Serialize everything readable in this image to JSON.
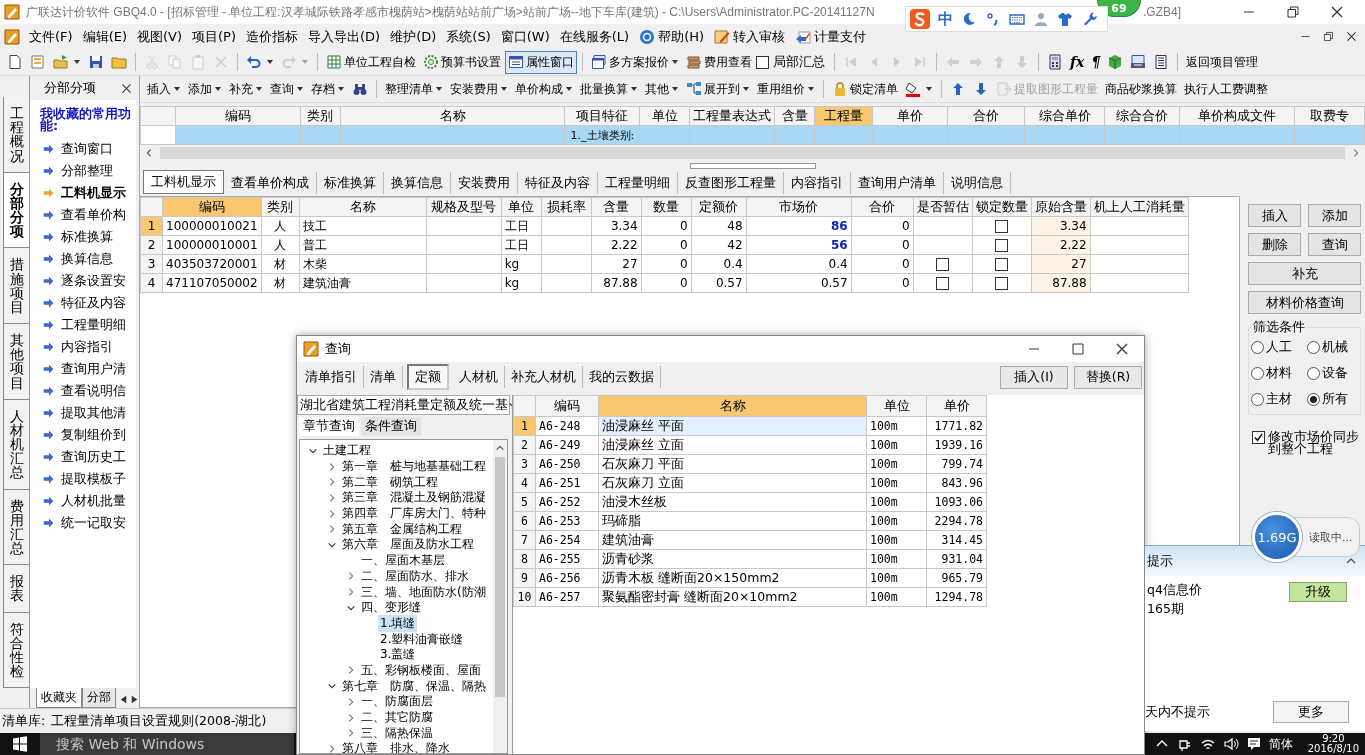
{
  "window": {
    "title": "广联达计价软件 GBQ4.0 - [招标管理 - 单位工程:汉孝城际铁路孝感市槐荫站>槐荫站站前广场>站前广场--地下车库(建筑) - C:\\Users\\Administrator.PC-20141127N",
    "title_end": ".GZB4]"
  },
  "badge": "69",
  "ime_bar": {
    "mode": "中"
  },
  "menu": [
    {
      "kind": "logo"
    },
    {
      "kind": "text",
      "label": "文件(F)"
    },
    {
      "kind": "text",
      "label": "编辑(E)"
    },
    {
      "kind": "text",
      "label": "视图(V)"
    },
    {
      "kind": "text",
      "label": "项目(P)"
    },
    {
      "kind": "text",
      "label": "造价指标"
    },
    {
      "kind": "text",
      "label": "导入导出(D)"
    },
    {
      "kind": "text",
      "label": "维护(D)"
    },
    {
      "kind": "text",
      "label": "系统(S)"
    },
    {
      "kind": "text",
      "label": "窗口(W)"
    },
    {
      "kind": "text",
      "label": "在线服务(L)"
    },
    {
      "kind": "help",
      "label": "帮助(H)"
    },
    {
      "kind": "review",
      "label": "转入审核"
    },
    {
      "kind": "pay",
      "label": "计量支付"
    }
  ],
  "toolbar_main": [
    {
      "kind": "new"
    },
    {
      "kind": "template"
    },
    {
      "kind": "open",
      "dropdown": true
    },
    {
      "kind": "save"
    },
    {
      "kind": "folder"
    },
    {
      "kind": "sep"
    },
    {
      "kind": "cut",
      "disabled": true
    },
    {
      "kind": "copy",
      "disabled": true
    },
    {
      "kind": "paste",
      "disabled": true
    },
    {
      "kind": "del",
      "disabled": true
    },
    {
      "kind": "sep"
    },
    {
      "kind": "undo",
      "dropdown": true,
      "disabled": false
    },
    {
      "kind": "redo",
      "dropdown": true,
      "disabled": true
    },
    {
      "kind": "sep"
    },
    {
      "kind": "check",
      "label": "单位工程自检"
    },
    {
      "kind": "gear",
      "label": "预算书设置"
    },
    {
      "kind": "window",
      "label": "属性窗口",
      "pressed": true
    },
    {
      "kind": "sep"
    },
    {
      "kind": "plans",
      "label": "多方案报价",
      "dropdown": true
    },
    {
      "kind": "fee",
      "label": "费用查看"
    },
    {
      "kind": "checkbox",
      "label": "局部汇总",
      "checked": false
    },
    {
      "kind": "sep"
    },
    {
      "kind": "first",
      "disabled": true
    },
    {
      "kind": "prev",
      "disabled": true
    },
    {
      "kind": "next",
      "disabled": true
    },
    {
      "kind": "last",
      "disabled": true
    },
    {
      "kind": "sep"
    },
    {
      "kind": "left",
      "disabled": true
    },
    {
      "kind": "right",
      "disabled": true
    },
    {
      "kind": "up",
      "disabled": true
    },
    {
      "kind": "down",
      "disabled": true
    },
    {
      "kind": "sep"
    },
    {
      "kind": "calc"
    },
    {
      "kind": "glyph",
      "label": "fx"
    },
    {
      "kind": "glyph",
      "label": "¶"
    },
    {
      "kind": "cube"
    },
    {
      "kind": "report"
    },
    {
      "kind": "list"
    },
    {
      "kind": "sep"
    },
    {
      "kind": "text",
      "label": "返回项目管理"
    }
  ],
  "side_tabs": [
    {
      "label": "工程概况",
      "selected": false
    },
    {
      "label": "分部分项",
      "selected": true
    },
    {
      "label": "措施项目",
      "selected": false
    },
    {
      "label": "其他项目",
      "selected": false
    },
    {
      "label": "人材机汇总",
      "selected": false
    },
    {
      "label": "费用汇总",
      "selected": false
    },
    {
      "label": "报表",
      "selected": false
    },
    {
      "label": "符合性检",
      "selected": false
    }
  ],
  "side_panel": {
    "title": "分部分项",
    "heading": "我收藏的常用功能:",
    "items": [
      {
        "label": "查询窗口",
        "selected": false
      },
      {
        "label": "分部整理",
        "selected": false
      },
      {
        "label": "工料机显示",
        "selected": true
      },
      {
        "label": "查看单价构",
        "selected": false
      },
      {
        "label": "标准换算",
        "selected": false
      },
      {
        "label": "换算信息",
        "selected": false
      },
      {
        "label": "逐条设置安",
        "selected": false
      },
      {
        "label": "特征及内容",
        "selected": false
      },
      {
        "label": "工程量明细",
        "selected": false
      },
      {
        "label": "内容指引",
        "selected": false
      },
      {
        "label": "查询用户清",
        "selected": false
      },
      {
        "label": "查看说明信",
        "selected": false
      },
      {
        "label": "提取其他清",
        "selected": false
      },
      {
        "label": "复制组价到",
        "selected": false
      },
      {
        "label": "查询历史工",
        "selected": false
      },
      {
        "label": "提取模板子",
        "selected": false
      },
      {
        "label": "人材机批量",
        "selected": false
      },
      {
        "label": "统一记取安",
        "selected": false
      }
    ],
    "bottom_tabs": [
      {
        "label": "收藏夹",
        "selected": true
      },
      {
        "label": "分部",
        "selected": false
      }
    ]
  },
  "toolbar_edit": [
    {
      "kind": "text",
      "label": "插入",
      "dropdown": true
    },
    {
      "kind": "text",
      "label": "添加",
      "dropdown": true
    },
    {
      "kind": "text",
      "label": "补充",
      "dropdown": true
    },
    {
      "kind": "text",
      "label": "查询",
      "dropdown": true
    },
    {
      "kind": "text",
      "label": "存档",
      "dropdown": true
    },
    {
      "kind": "binoculars"
    },
    {
      "kind": "sep"
    },
    {
      "kind": "text",
      "label": "整理清单",
      "dropdown": true
    },
    {
      "kind": "text",
      "label": "安装费用",
      "dropdown": true
    },
    {
      "kind": "text",
      "label": "单价构成",
      "dropdown": true
    },
    {
      "kind": "text",
      "label": "批量换算",
      "dropdown": true
    },
    {
      "kind": "text",
      "label": "其他",
      "dropdown": true
    },
    {
      "kind": "expand",
      "label": "展开到",
      "dropdown": true
    },
    {
      "kind": "text",
      "label": "重用组价",
      "dropdown": true
    },
    {
      "kind": "sep"
    },
    {
      "kind": "lock",
      "label": "锁定清单"
    },
    {
      "kind": "paint",
      "dropdown": true
    },
    {
      "kind": "sep"
    },
    {
      "kind": "bup"
    },
    {
      "kind": "bdown"
    },
    {
      "kind": "extract",
      "label": "提取图形工程量",
      "disabled": true
    },
    {
      "kind": "text",
      "label": "商品砂浆换算"
    },
    {
      "kind": "text",
      "label": "执行人工费调整"
    }
  ],
  "item_grid": {
    "columns": [
      {
        "label": "编码",
        "selected": false
      },
      {
        "label": "类别",
        "selected": false
      },
      {
        "label": "名称",
        "selected": false
      },
      {
        "label": "项目特征",
        "selected": false
      },
      {
        "label": "单位",
        "selected": false
      },
      {
        "label": "工程量表达式",
        "selected": false
      },
      {
        "label": "含量",
        "selected": false
      },
      {
        "label": "工程量",
        "selected": true
      },
      {
        "label": "单价",
        "selected": false
      },
      {
        "label": "合价",
        "selected": false
      },
      {
        "label": "综合单价",
        "selected": false
      },
      {
        "label": "综合合价",
        "selected": false
      },
      {
        "label": "单价构成文件",
        "selected": false
      },
      {
        "label": "取费专",
        "selected": false
      }
    ],
    "rows": [
      {
        "selected": true,
        "feature": "1._土壤类别:"
      }
    ]
  },
  "detail_tabs": [
    {
      "label": "工料机显示",
      "selected": true
    },
    {
      "label": "查看单价构成",
      "selected": false
    },
    {
      "label": "标准换算",
      "selected": false
    },
    {
      "label": "换算信息",
      "selected": false
    },
    {
      "label": "安装费用",
      "selected": false
    },
    {
      "label": "特征及内容",
      "selected": false
    },
    {
      "label": "工程量明细",
      "selected": false
    },
    {
      "label": "反查图形工程量",
      "selected": false
    },
    {
      "label": "内容指引",
      "selected": false
    },
    {
      "label": "查询用户清单",
      "selected": false
    },
    {
      "label": "说明信息",
      "selected": false
    }
  ],
  "resources": {
    "columns": [
      {
        "label": "编码",
        "selected": true
      },
      {
        "label": "类别",
        "selected": false
      },
      {
        "label": "名称",
        "selected": false
      },
      {
        "label": "规格及型号",
        "selected": false
      },
      {
        "label": "单位",
        "selected": false
      },
      {
        "label": "损耗率",
        "selected": false
      },
      {
        "label": "含量",
        "selected": false
      },
      {
        "label": "数量",
        "selected": false
      },
      {
        "label": "定额价",
        "selected": false
      },
      {
        "label": "市场价",
        "selected": false
      },
      {
        "label": "合价",
        "selected": false
      },
      {
        "label": "是否暂估",
        "selected": false
      },
      {
        "label": "锁定数量",
        "selected": false
      },
      {
        "label": "原始含量",
        "selected": false
      },
      {
        "label": "机上人工消耗量",
        "selected": false
      }
    ],
    "rows": [
      {
        "no": "1",
        "selected": true,
        "code": "100000010021",
        "type": "人",
        "name": "技工",
        "unit": "工日",
        "content": "3.34",
        "qty": "0",
        "quota_price": "48",
        "market_price": "86",
        "market_changed": true,
        "total": "0",
        "locked": false,
        "original": "3.34"
      },
      {
        "no": "2",
        "selected": false,
        "code": "100000010001",
        "type": "人",
        "name": "普工",
        "unit": "工日",
        "content": "2.22",
        "qty": "0",
        "quota_price": "42",
        "market_price": "56",
        "market_changed": true,
        "total": "0",
        "locked": false,
        "original": "2.22"
      },
      {
        "no": "3",
        "selected": false,
        "code": "403503720001",
        "type": "材",
        "name": "木柴",
        "unit": "kg",
        "content": "27",
        "qty": "0",
        "quota_price": "0.4",
        "market_price": "0.4",
        "market_changed": false,
        "total": "0",
        "estimate": false,
        "locked": false,
        "original": "27"
      },
      {
        "no": "4",
        "selected": false,
        "code": "471107050002",
        "type": "材",
        "name": "建筑油膏",
        "unit": "kg",
        "content": "87.88",
        "qty": "0",
        "quota_price": "0.57",
        "market_price": "0.57",
        "market_changed": false,
        "total": "0",
        "estimate": false,
        "locked": false,
        "original": "87.88"
      }
    ]
  },
  "side_buttons": [
    {
      "label": "插入",
      "kind": "half"
    },
    {
      "label": "添加",
      "kind": "half"
    },
    {
      "label": "删除",
      "kind": "half"
    },
    {
      "label": "查询",
      "kind": "half"
    },
    {
      "label": "补充",
      "kind": "full"
    },
    {
      "label": "材料价格查询",
      "kind": "full"
    }
  ],
  "filter": {
    "title": "筛选条件",
    "options": [
      {
        "label": "人工",
        "selected": false
      },
      {
        "label": "机械",
        "selected": false
      },
      {
        "label": "材料",
        "selected": false
      },
      {
        "label": "设备",
        "selected": false
      },
      {
        "label": "主材",
        "selected": false
      },
      {
        "label": "所有",
        "selected": true
      }
    ]
  },
  "sync_option": {
    "label": "修改市场价同步到整个工程",
    "checked": true
  },
  "status_bar": {
    "label": "清单库:",
    "value": "工程量清单项目设置规则(2008-湖北)"
  },
  "taskbar": {
    "search": {
      "placeholder": "搜索 Web 和 Windows"
    },
    "input_method": "简体",
    "time": "9:20",
    "date": "2016/8/10"
  },
  "dialog": {
    "title": "查询",
    "tabs": [
      {
        "label": "清单指引",
        "selected": false
      },
      {
        "label": "清单",
        "selected": false
      },
      {
        "label": "定额",
        "selected": true
      },
      {
        "label": "人材机",
        "selected": false
      },
      {
        "label": "补充人材机",
        "selected": false
      },
      {
        "label": "我的云数据",
        "selected": false
      }
    ],
    "buttons": [
      "插入(I)",
      "替换(R)"
    ],
    "library": "湖北省建筑工程消耗量定额及统一基",
    "subtabs": [
      {
        "label": "章节查询",
        "selected": true
      },
      {
        "label": "条件查询",
        "selected": false
      }
    ],
    "tree": [
      {
        "label": "土建工程",
        "expanded": true,
        "selected": false,
        "children": [
          {
            "label": "第一章　桩与地基基础工程",
            "expanded": false,
            "selected": false
          },
          {
            "label": "第二章　砌筑工程",
            "expanded": false,
            "selected": false
          },
          {
            "label": "第三章　混凝土及钢筋混凝",
            "expanded": false,
            "selected": false
          },
          {
            "label": "第四章　厂库房大门、特种",
            "expanded": false,
            "selected": false
          },
          {
            "label": "第五章　金属结构工程",
            "expanded": false,
            "selected": false
          },
          {
            "label": "第六章　屋面及防水工程",
            "expanded": true,
            "selected": false,
            "children": [
              {
                "label": "一、屋面木基层",
                "selected": false
              },
              {
                "label": "二、屋面防水、排水",
                "expanded": false,
                "selected": false
              },
              {
                "label": "三、墙、地面防水(防潮",
                "expanded": false,
                "selected": false
              },
              {
                "label": "四、变形缝",
                "expanded": true,
                "selected": false,
                "children": [
                  {
                    "label": "1.填缝",
                    "selected": true
                  },
                  {
                    "label": "2.塑料油膏嵌缝",
                    "selected": false
                  },
                  {
                    "label": "3.盖缝",
                    "selected": false
                  }
                ]
              },
              {
                "label": "五、彩钢板楼面、屋面",
                "expanded": false,
                "selected": false
              }
            ]
          },
          {
            "label": "第七章　防腐、保温、隔热",
            "expanded": true,
            "selected": false,
            "children": [
              {
                "label": "一、防腐面层",
                "expanded": false,
                "selected": false
              },
              {
                "label": "二、其它防腐",
                "expanded": false,
                "selected": false
              },
              {
                "label": "三、隔热保温",
                "expanded": false,
                "selected": false
              }
            ]
          },
          {
            "label": "第八章　排水、降水",
            "expanded": false,
            "selected": false
          }
        ]
      }
    ],
    "table": {
      "columns": [
        {
          "label": "编码",
          "selected": false
        },
        {
          "label": "名称",
          "selected": true
        },
        {
          "label": "单位",
          "selected": false
        },
        {
          "label": "单价",
          "selected": false
        }
      ],
      "rows": [
        {
          "no": "1",
          "code": "A6-248",
          "name": "油浸麻丝 平面",
          "unit": "100m",
          "price": "1771.82",
          "selected": true
        },
        {
          "no": "2",
          "code": "A6-249",
          "name": "油浸麻丝 立面",
          "unit": "100m",
          "price": "1939.16",
          "selected": false
        },
        {
          "no": "3",
          "code": "A6-250",
          "name": "石灰麻刀 平面",
          "unit": "100m",
          "price": "799.74",
          "selected": false
        },
        {
          "no": "4",
          "code": "A6-251",
          "name": "石灰麻刀 立面",
          "unit": "100m",
          "price": "843.96",
          "selected": false
        },
        {
          "no": "5",
          "code": "A6-252",
          "name": "油浸木丝板",
          "unit": "100m",
          "price": "1093.06",
          "selected": false
        },
        {
          "no": "6",
          "code": "A6-253",
          "name": "玛碲脂",
          "unit": "100m",
          "price": "2294.78",
          "selected": false
        },
        {
          "no": "7",
          "code": "A6-254",
          "name": "建筑油膏",
          "unit": "100m",
          "price": "314.45",
          "selected": false
        },
        {
          "no": "8",
          "code": "A6-255",
          "name": "沥青砂浆",
          "unit": "100m",
          "price": "931.04",
          "selected": false
        },
        {
          "no": "9",
          "code": "A6-256",
          "name": "沥青木板 缝断面20×150mm2",
          "unit": "100m",
          "price": "965.79",
          "selected": false
        },
        {
          "no": "10",
          "code": "A6-257",
          "name": "聚氨酯密封膏 缝断面20×10mm2",
          "unit": "100m",
          "price": "1294.78",
          "selected": false
        }
      ]
    }
  },
  "tip": {
    "title": "提示",
    "lines": [
      "q4信息价",
      "165期"
    ],
    "action": "升级",
    "footer": "天内不提示",
    "more": "更多"
  },
  "memory_bubble": {
    "value": "1.69G",
    "status": "读取中..."
  }
}
